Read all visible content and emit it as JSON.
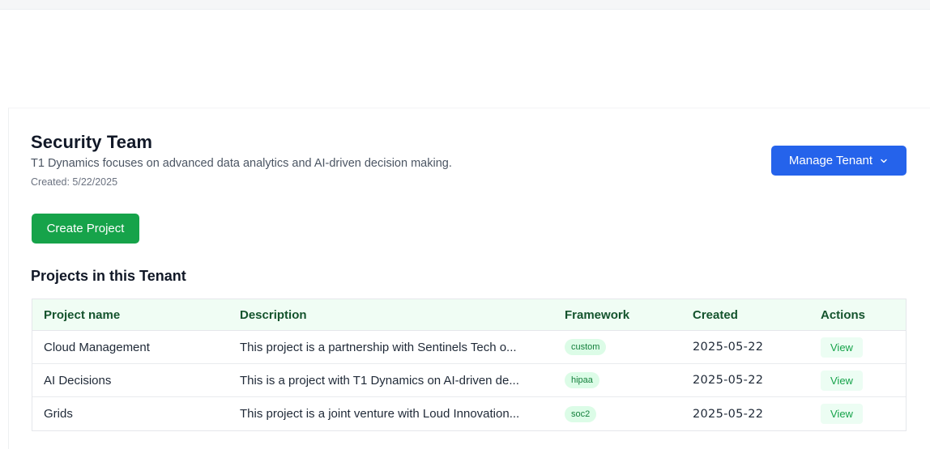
{
  "tenant": {
    "name": "Security Team",
    "description": "T1 Dynamics focuses on advanced data analytics and AI-driven decision making.",
    "created": "Created: 5/22/2025"
  },
  "actions": {
    "manage_tenant_label": "Manage Tenant",
    "create_project_label": "Create Project"
  },
  "projects_section": {
    "title": "Projects in this Tenant",
    "columns": [
      "Project name",
      "Description",
      "Framework",
      "Created",
      "Actions"
    ],
    "rows": [
      {
        "name": "Cloud Management",
        "description": "This project is a partnership with Sentinels Tech o...",
        "framework": "custom",
        "created": "2025-05-22",
        "action": "View"
      },
      {
        "name": "AI Decisions",
        "description": "This is a project with T1 Dynamics on AI-driven de...",
        "framework": "hipaa",
        "created": "2025-05-22",
        "action": "View"
      },
      {
        "name": "Grids",
        "description": "This project is a joint venture with Loud Innovation...",
        "framework": "soc2",
        "created": "2025-05-22",
        "action": "View"
      }
    ]
  },
  "colors": {
    "primary": "#2563eb",
    "success": "#16a34a",
    "table_header_bg": "#f0fdf4",
    "badge_bg": "#dcfce7"
  },
  "icons": {
    "manage_dropdown": "chevron-down-icon"
  }
}
